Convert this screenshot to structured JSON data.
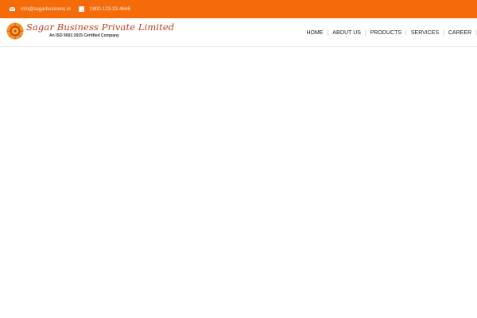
{
  "topbar": {
    "email": "info@sagarbusiness.in",
    "phone": "1800-123-33-4646",
    "email_icon": "envelope-icon",
    "phone_icon": "phone-icon",
    "background": "#f56b0a"
  },
  "logo": {
    "company_name": "Sagar Business Private Limited",
    "tagline": "An ISO 9001:2015 Certified Company"
  },
  "nav": {
    "items": [
      {
        "label": "HOME"
      },
      {
        "label": "ABOUT US"
      },
      {
        "label": "PRODUCTS"
      },
      {
        "label": "SERVICES"
      },
      {
        "label": "CAREER"
      }
    ]
  }
}
